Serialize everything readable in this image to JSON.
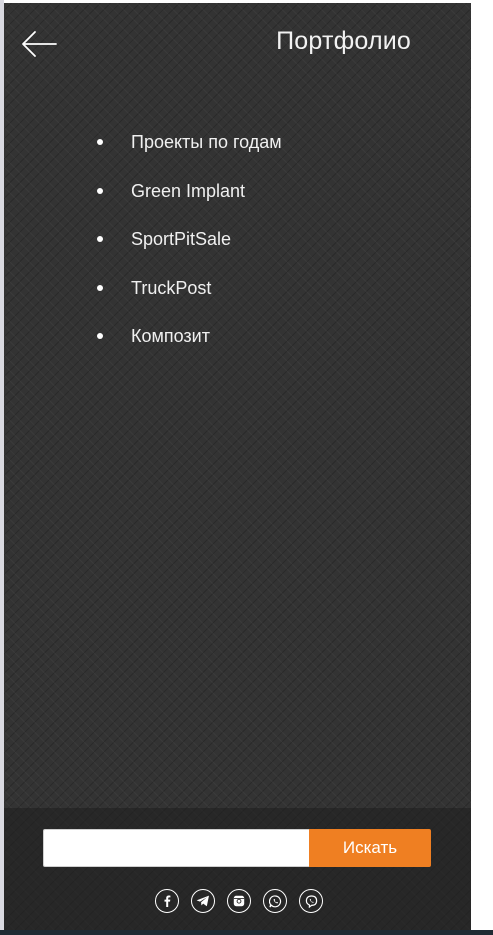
{
  "header": {
    "title": "Портфолио"
  },
  "menu": {
    "items": [
      {
        "label": "Проекты по годам"
      },
      {
        "label": "Green Implant"
      },
      {
        "label": "SportPitSale"
      },
      {
        "label": "TruckPost"
      },
      {
        "label": "Композит"
      }
    ]
  },
  "search": {
    "value": "",
    "placeholder": "",
    "button_label": "Искать"
  },
  "socials": {
    "icons": [
      "facebook-icon",
      "telegram-icon",
      "instagram-icon",
      "whatsapp-icon",
      "viber-icon"
    ]
  },
  "colors": {
    "panel_background": "#333333",
    "accent": "#ef7f22",
    "text": "#f0f0f0"
  }
}
